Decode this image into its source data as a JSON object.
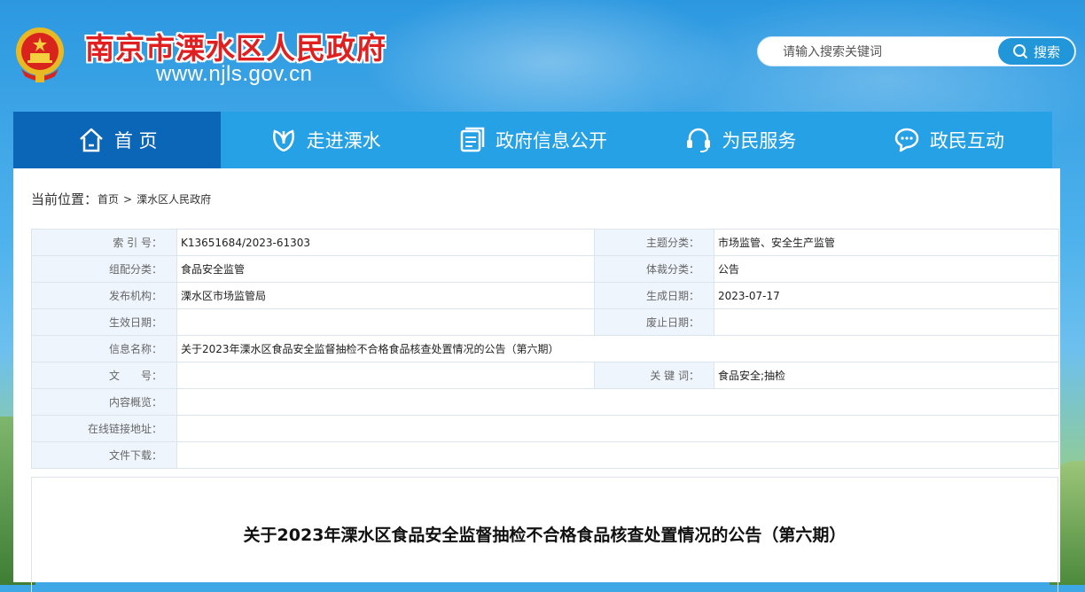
{
  "header": {
    "site_title": "南京市溧水区人民政府",
    "site_url": "www.njls.gov.cn",
    "search_placeholder": "请输入搜索关键词",
    "search_button": "搜索"
  },
  "nav": {
    "items": [
      {
        "label": "首 页",
        "icon": "home-icon"
      },
      {
        "label": "走进溧水",
        "icon": "leaf-icon"
      },
      {
        "label": "政府信息公开",
        "icon": "document-icon"
      },
      {
        "label": "为民服务",
        "icon": "headset-icon"
      },
      {
        "label": "政民互动",
        "icon": "chat-icon"
      }
    ]
  },
  "breadcrumb": {
    "prefix": "当前位置：",
    "items": [
      "首页",
      "溧水区人民政府"
    ],
    "separator": ">"
  },
  "meta": {
    "index_no_label": "索 引 号：",
    "index_no": "K13651684/2023-61303",
    "topic_label": "主题分类：",
    "topic": "市场监管、安全生产监管",
    "category_label": "组配分类：",
    "category": "食品安全监管",
    "genre_label": "体裁分类：",
    "genre": "公告",
    "publisher_label": "发布机构：",
    "publisher": "溧水区市场监管局",
    "created_label": "生成日期：",
    "created": "2023-07-17",
    "effective_label": "生效日期：",
    "effective": "",
    "expired_label": "废止日期：",
    "expired": "",
    "name_label": "信息名称：",
    "name": "关于2023年溧水区食品安全监督抽检不合格食品核查处置情况的公告（第六期）",
    "doc_no_label": "文　　号：",
    "doc_no": "",
    "keywords_label": "关 键 词：",
    "keywords": "食品安全;抽检",
    "summary_label": "内容概览：",
    "summary": "",
    "link_label": "在线链接地址：",
    "link": "",
    "download_label": "文件下载：",
    "download": ""
  },
  "article": {
    "title": "关于2023年溧水区食品安全监督抽检不合格食品核查处置情况的公告（第六期）"
  }
}
